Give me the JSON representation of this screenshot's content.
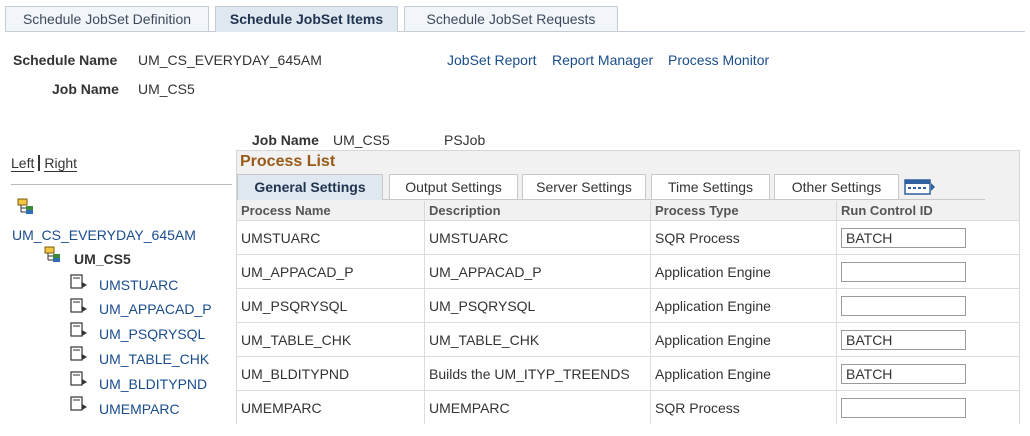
{
  "top_tabs": [
    {
      "label": "Schedule JobSet Definition",
      "active": false
    },
    {
      "label": "Schedule JobSet Items",
      "active": true
    },
    {
      "label": "Schedule JobSet Requests",
      "active": false
    }
  ],
  "header": {
    "schedule_name_label": "Schedule Name",
    "schedule_name_value": "UM_CS_EVERYDAY_645AM",
    "job_name_label": "Job Name",
    "job_name_value": "UM_CS5",
    "links": [
      "JobSet Report",
      "Report Manager",
      "Process Monitor"
    ]
  },
  "left_right": {
    "left": "Left",
    "right": "Right"
  },
  "tree": {
    "root": "UM_CS_EVERYDAY_645AM",
    "job": "UM_CS5",
    "items": [
      "UMSTUARC",
      "UM_APPACAD_P",
      "UM_PSQRYSQL",
      "UM_TABLE_CHK",
      "UM_BLDITYPND",
      "UMEMPARC"
    ]
  },
  "job_info": {
    "label": "Job Name",
    "value": "UM_CS5",
    "type": "PSJob"
  },
  "process_list": {
    "title": "Process List",
    "tabs": [
      {
        "label": "General Settings",
        "active": true
      },
      {
        "label": "Output Settings",
        "active": false
      },
      {
        "label": "Server Settings",
        "active": false
      },
      {
        "label": "Time Settings",
        "active": false
      },
      {
        "label": "Other Settings",
        "active": false
      }
    ],
    "columns": [
      "Process Name",
      "Description",
      "Process Type",
      "Run Control ID"
    ],
    "rows": [
      {
        "name": "UMSTUARC",
        "description": "UMSTUARC",
        "type": "SQR Process",
        "run_control": "BATCH"
      },
      {
        "name": "UM_APPACAD_P",
        "description": "UM_APPACAD_P",
        "type": "Application Engine",
        "run_control": ""
      },
      {
        "name": "UM_PSQRYSQL",
        "description": "UM_PSQRYSQL",
        "type": "Application Engine",
        "run_control": ""
      },
      {
        "name": "UM_TABLE_CHK",
        "description": "UM_TABLE_CHK",
        "type": "Application Engine",
        "run_control": "BATCH"
      },
      {
        "name": "UM_BLDITYPND",
        "description": "Builds the UM_ITYP_TREENDS",
        "type": "Application Engine",
        "run_control": "BATCH"
      },
      {
        "name": "UMEMPARC",
        "description": "UMEMPARC",
        "type": "SQR Process",
        "run_control": ""
      }
    ]
  },
  "colors": {
    "link": "#1a4d8c",
    "panel_title": "#9a5a1a",
    "active_tab": "#dfe7f0"
  }
}
